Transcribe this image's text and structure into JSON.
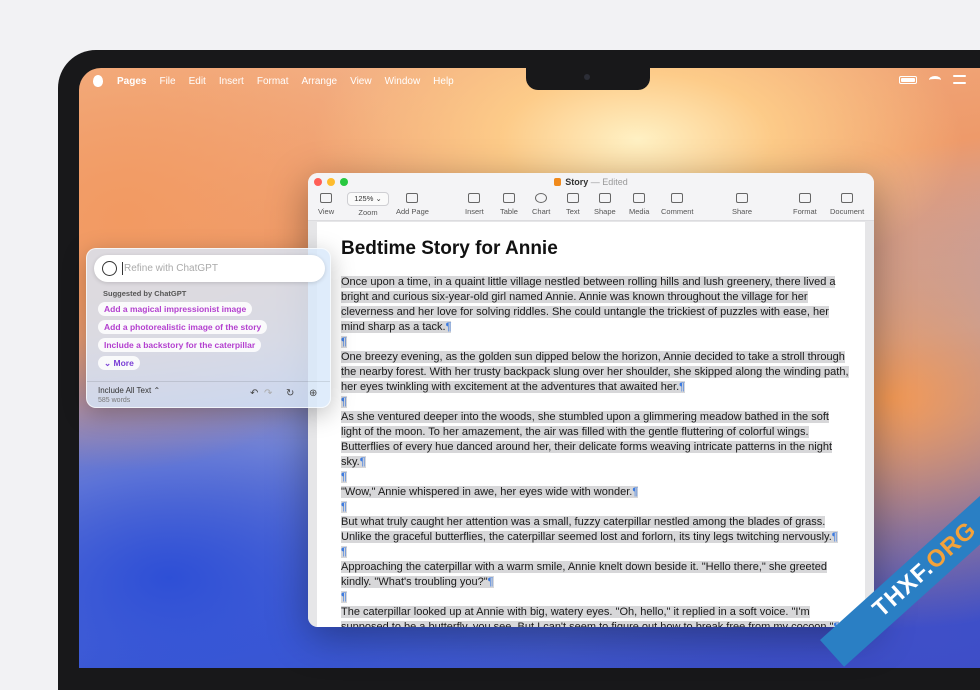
{
  "menubar": {
    "app": "Pages",
    "items": [
      "File",
      "Edit",
      "Insert",
      "Format",
      "Arrange",
      "View",
      "Window",
      "Help"
    ]
  },
  "window": {
    "doc_name": "Story",
    "status": "Edited",
    "separator": "—",
    "toolbar": {
      "view": "View",
      "zoom_value": "125%",
      "zoom": "Zoom",
      "add_page": "Add Page",
      "insert": "Insert",
      "table": "Table",
      "chart": "Chart",
      "text": "Text",
      "shape": "Shape",
      "media": "Media",
      "comment": "Comment",
      "share": "Share",
      "format": "Format",
      "document": "Document"
    },
    "doc_title": "Bedtime Story for Annie",
    "paragraphs": [
      "Once upon a time, in a quaint little village nestled between rolling hills and lush greenery, there lived a bright and curious six-year-old girl named Annie. Annie was known throughout the village for her cleverness and her love for solving riddles. She could untangle the trickiest of puzzles with ease, her mind sharp as a tack.",
      "One breezy evening, as the golden sun dipped below the horizon, Annie decided to take a stroll through the nearby forest. With her trusty backpack slung over her shoulder, she skipped along the winding path, her eyes twinkling with excitement at the adventures that awaited her.",
      "As she ventured deeper into the woods, she stumbled upon a glimmering meadow bathed in the soft light of the moon. To her amazement, the air was filled with the gentle fluttering of colorful wings. Butterflies of every hue danced around her, their delicate forms weaving intricate patterns in the night sky.",
      "\"Wow,\" Annie whispered in awe, her eyes wide with wonder.",
      "But what truly caught her attention was a small, fuzzy caterpillar nestled among the blades of grass. Unlike the graceful butterflies, the caterpillar seemed lost and forlorn, its tiny legs twitching nervously.",
      "Approaching the caterpillar with a warm smile, Annie knelt down beside it. \"Hello there,\" she greeted kindly. \"What's troubling you?\"",
      "The caterpillar looked up at Annie with big, watery eyes. \"Oh, hello,\" it replied in a soft voice. \"I'm supposed to be a butterfly, you see. But I can't seem to figure out how to break free from my cocoon.\""
    ],
    "pilcrow": "¶"
  },
  "writing_tools": {
    "placeholder": "Refine with ChatGPT",
    "suggested_heading": "Suggested by ChatGPT",
    "suggestions": [
      "Add a magical impressionist image",
      "Add a photorealistic image of the story",
      "Include a backstory for the caterpillar"
    ],
    "more": "More",
    "include": "Include All Text",
    "word_count": "585 words"
  },
  "watermark": {
    "text": "THXF.",
    "accent": "ORG"
  },
  "colors": {
    "accent": "#3d7be0",
    "suggestion": "#b33fcf",
    "selection": "#d7d7d9"
  }
}
